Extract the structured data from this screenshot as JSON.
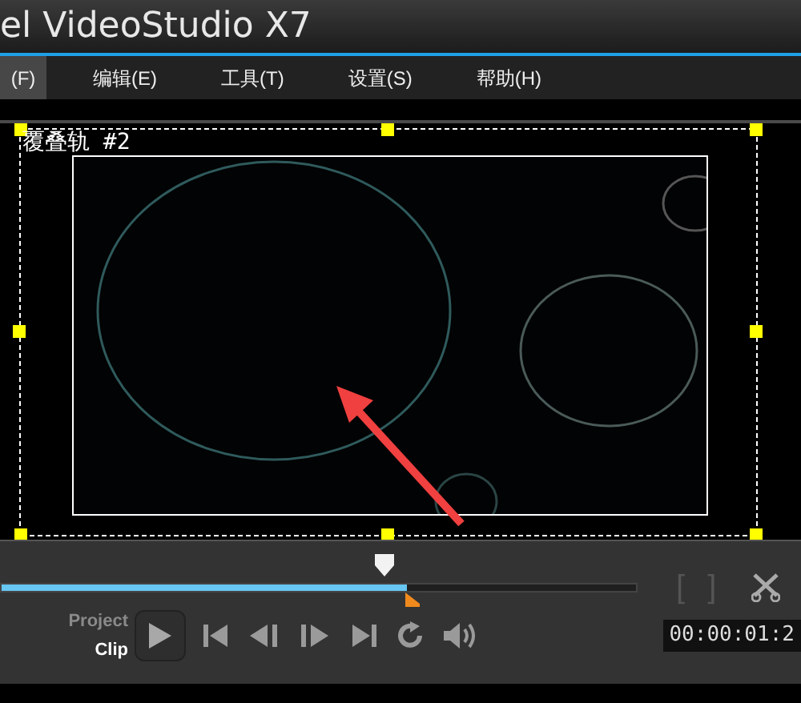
{
  "window": {
    "title": "el VideoStudio X7"
  },
  "menu": [
    {
      "label": "(F)",
      "selected": true
    },
    {
      "label": "编辑(E)",
      "selected": false
    },
    {
      "label": "工具(T)",
      "selected": false
    },
    {
      "label": "设置(S)",
      "selected": false
    },
    {
      "label": "帮助(H)",
      "selected": false
    }
  ],
  "preview": {
    "track_label": "覆叠轨 #2"
  },
  "scrubber": {
    "level": 0.64
  },
  "modes": [
    {
      "label": "Project",
      "selected": false
    },
    {
      "label": "Clip",
      "selected": true
    }
  ],
  "trim_buttons": [
    "[",
    "]"
  ],
  "timecode": "00:00:01:2"
}
